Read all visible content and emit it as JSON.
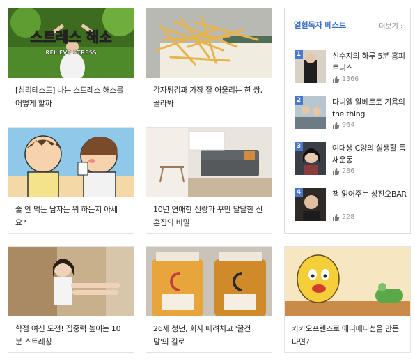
{
  "cards": [
    {
      "title": "[심리테스트] 나는 스트레스 해소를 어떻게 할까",
      "thumb_text_main": "스트레스 해소",
      "thumb_text_sub": "RELIEVE STRESS"
    },
    {
      "title": "감자튀김과 가장 잘 어울리는 한 쌍, 골라봐"
    },
    {
      "title": "술 안 먹는 남자는 뭐 하는지 아세요?"
    },
    {
      "title": "10년 연애한 신랑과 꾸민 달달한 신혼집의 비밀"
    },
    {
      "title": "학점 여신 도전! 집중력 높이는 10분 스트레칭"
    },
    {
      "title": "26세 청년, 회사 때려치고 '꿀건달'의 길로"
    },
    {
      "title": "카카오프렌즈로 애니매니션을 만든다면?"
    }
  ],
  "sidebar": {
    "title": "열혈독자 베스트",
    "more": "더보기 ›",
    "items": [
      {
        "rank": "1",
        "title": "신수지의 하루 5분 홈피트니스",
        "likes": "1366"
      },
      {
        "rank": "2",
        "title": "다니엘 알베르토 기욤의 the thing",
        "likes": "964"
      },
      {
        "rank": "3",
        "title": "여대생 C양의 실생활 틈새운동",
        "likes": "286"
      },
      {
        "rank": "4",
        "title": "책 읽어주는 상진오BAR",
        "likes": "228"
      }
    ]
  },
  "colors": {
    "accent": "#3b6fc4",
    "rank_badge": "#4a78c9"
  }
}
